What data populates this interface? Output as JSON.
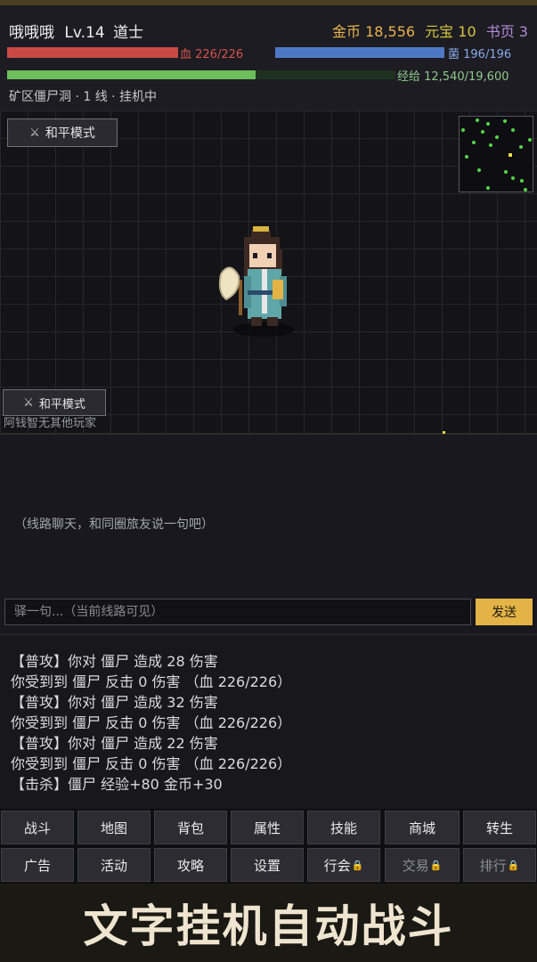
{
  "player": {
    "name": "哦哦哦",
    "level": "Lv.14",
    "class": "道士"
  },
  "currency": {
    "gold": "金币 18,556",
    "yuanbao": "元宝 10",
    "shuye": "书页 3"
  },
  "bars": {
    "hp": {
      "text": "血 226/226",
      "fraction": 1.0
    },
    "mp": {
      "text": "菌 196/196",
      "fraction": 1.0
    },
    "exp": {
      "text": "经给 12,540/19,600",
      "fraction": 0.64
    }
  },
  "location": "矿区僵尸洞 · 1 线 · 挂机中",
  "field": {
    "mode_top": "和平模式",
    "mode_bottom": "和平模式",
    "no_players": "阿钱智无其他玩家"
  },
  "chat": {
    "hint": "（线路聊天，和同圈旅友说一句吧）",
    "placeholder": "驿一句...（当前线路可见）",
    "send": "发送"
  },
  "battle_log": [
    "【普攻】你对 僵尸 造成 28 伤害",
    "你受到到 僵尸 反击 0 伤害 （血 226/226）",
    "【普攻】你对 僵尸 造成 32 伤害",
    "你受到到 僵尸 反击 0 伤害 （血 226/226）",
    "【普攻】你对 僵尸 造成 22 伤害",
    "你受到到 僵尸 反击 0 伤害 （血 226/226）",
    "【击杀】僵尸 经验+80 金币+30"
  ],
  "menu": [
    {
      "label": "战斗",
      "locked": false
    },
    {
      "label": "地图",
      "locked": false
    },
    {
      "label": "背包",
      "locked": false
    },
    {
      "label": "属性",
      "locked": false
    },
    {
      "label": "技能",
      "locked": false
    },
    {
      "label": "商城",
      "locked": false
    },
    {
      "label": "转生",
      "locked": false
    },
    {
      "label": "广告",
      "locked": false
    },
    {
      "label": "活动",
      "locked": false
    },
    {
      "label": "攻略",
      "locked": false
    },
    {
      "label": "设置",
      "locked": false
    },
    {
      "label": "行会",
      "locked": true
    },
    {
      "label": "交易",
      "locked": true
    },
    {
      "label": "排行",
      "locked": true
    }
  ],
  "banner": "文字挂机自动战斗",
  "colors": {
    "accent": "#e3b347",
    "hp": "#c94a45",
    "mp": "#4f78c4",
    "exp": "#6cbf5a"
  },
  "icons": {
    "mode": "crossed-swords-icon",
    "lock": "lock-icon"
  }
}
